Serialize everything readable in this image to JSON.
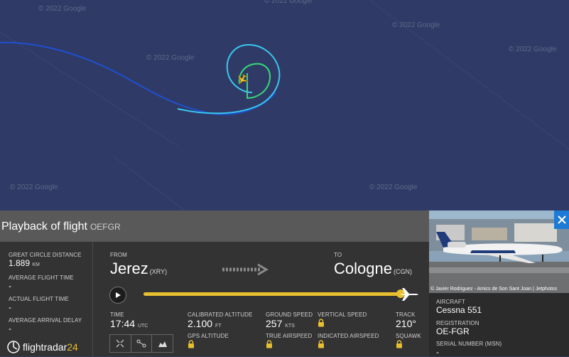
{
  "map": {
    "watermark": "© 2022 Google",
    "colors": {
      "ocean": "#2f3b66",
      "track_dark": "#1f4fd1",
      "track_light": "#39c8f0",
      "track_green": "#35d97a",
      "plane": "#f2c12e"
    }
  },
  "panel": {
    "title": "Playback of flight",
    "registration": "OEFGR",
    "stats": [
      {
        "label": "GREAT CIRCLE DISTANCE",
        "value": "1.889",
        "unit": "KM"
      },
      {
        "label": "AVERAGE FLIGHT TIME",
        "value": "-"
      },
      {
        "label": "ACTUAL FLIGHT TIME",
        "value": "-"
      },
      {
        "label": "AVERAGE ARRIVAL DELAY",
        "value": "-"
      }
    ],
    "from": {
      "label": "FROM",
      "city": "Jerez",
      "code": "(XRY)"
    },
    "to": {
      "label": "TO",
      "city": "Cologne",
      "code": "(CGN)"
    },
    "playback_progress": 1.0,
    "time": {
      "label": "TIME",
      "value": "17:44",
      "unit": "UTC"
    },
    "calibrated_altitude": {
      "label": "CALIBRATED ALTITUDE",
      "value": "2.100",
      "unit": "FT"
    },
    "gps_altitude": {
      "label": "GPS ALTITUDE"
    },
    "ground_speed": {
      "label": "GROUND SPEED",
      "value": "257",
      "unit": "KTS"
    },
    "true_airspeed": {
      "label": "TRUE AIRSPEED"
    },
    "vertical_speed": {
      "label": "VERTICAL SPEED"
    },
    "indicated_airspeed": {
      "label": "INDICATED AIRSPEED"
    },
    "track": {
      "label": "TRACK",
      "value": "210°"
    },
    "squawk": {
      "label": "SQUAWK"
    },
    "tools": [
      "expand-icon",
      "route-icon",
      "chart-icon"
    ],
    "logo": {
      "main": "flightradar",
      "num": "24"
    }
  },
  "aircraft_panel": {
    "photo_credit": "© Javier Rodriguez - Amics de Son Sant Joan | Jetphotos",
    "aircraft_label": "AIRCRAFT",
    "aircraft_value": "Cessna 551",
    "registration_label": "REGISTRATION",
    "registration_value": "OE-FGR",
    "serial_label": "SERIAL NUMBER (MSN)",
    "serial_value": "-"
  }
}
